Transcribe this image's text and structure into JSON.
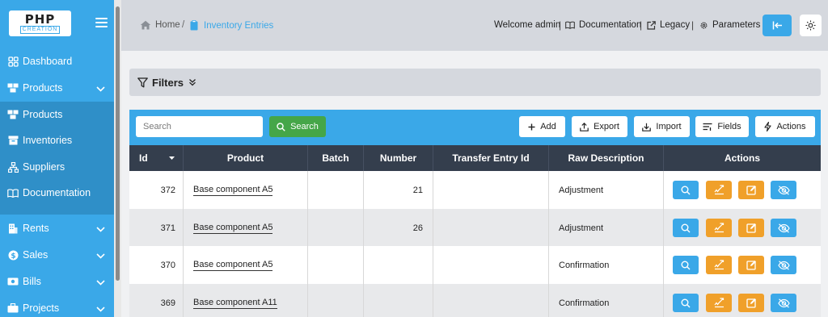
{
  "logo": {
    "top": "PHP",
    "bottom": "CREATION"
  },
  "sidebar": {
    "items": [
      {
        "label": "Dashboard",
        "icon": "palette-icon"
      },
      {
        "label": "Products",
        "icon": "boxes-icon",
        "expanded": true
      },
      {
        "label": "Products",
        "icon": "boxes-icon"
      },
      {
        "label": "Inventories",
        "icon": "archive-icon"
      },
      {
        "label": "Suppliers",
        "icon": "sitemap-icon"
      },
      {
        "label": "Documentation",
        "icon": "book-icon"
      },
      {
        "label": "Rents",
        "icon": "building-icon"
      },
      {
        "label": "Sales",
        "icon": "dollar-circle-icon"
      },
      {
        "label": "Bills",
        "icon": "money-bill-icon"
      },
      {
        "label": "Projects",
        "icon": "briefcase-icon"
      }
    ]
  },
  "breadcrumb": {
    "home": "Home",
    "separator": "/",
    "current": "Inventory Entries"
  },
  "header": {
    "welcome": "Welcome admin",
    "documentation": "Documentation",
    "legacy": "Legacy",
    "parameters": "Parameters",
    "separator": "|"
  },
  "filters": {
    "label": "Filters"
  },
  "toolbar": {
    "search_placeholder": "Search",
    "search_label": "Search",
    "add_label": "Add",
    "export_label": "Export",
    "import_label": "Import",
    "fields_label": "Fields",
    "actions_label": "Actions"
  },
  "table": {
    "columns": [
      "Id",
      "Product",
      "Batch",
      "Number",
      "Transfer Entry Id",
      "Raw Description",
      "Actions"
    ],
    "rows": [
      {
        "id": "372",
        "product": "Base component A5",
        "batch": "",
        "number": "21",
        "transfer": "",
        "raw": "Adjustment"
      },
      {
        "id": "371",
        "product": "Base component A5",
        "batch": "",
        "number": "26",
        "transfer": "",
        "raw": "Adjustment"
      },
      {
        "id": "370",
        "product": "Base component A5",
        "batch": "",
        "number": "",
        "transfer": "",
        "raw": "Confirmation"
      },
      {
        "id": "369",
        "product": "Base component A11",
        "batch": "",
        "number": "",
        "transfer": "",
        "raw": "Confirmation"
      }
    ]
  },
  "colors": {
    "primary": "#3aa8e8",
    "sidebar_submenu": "#2f8fc8",
    "header_dark": "#343e4d",
    "success": "#45a648",
    "warning": "#f0a02a"
  }
}
